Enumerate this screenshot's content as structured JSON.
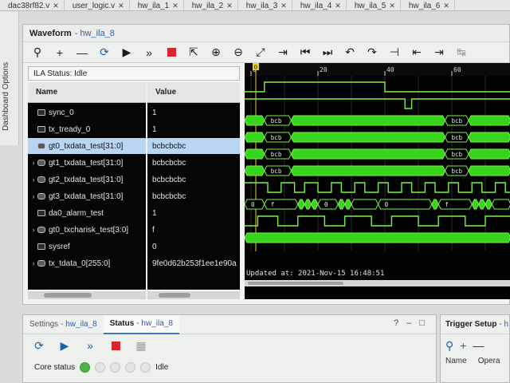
{
  "file_tabs": [
    "dac38rf82.v",
    "user_logic.v",
    "hw_ila_1",
    "hw_ila_2",
    "hw_ila_3",
    "hw_ila_4",
    "hw_ila_5",
    "hw_ila_6"
  ],
  "dashboard_label": "Dashboard Options",
  "waveform": {
    "title": "Waveform",
    "subtitle": "- hw_ila_8",
    "ila_status": "ILA Status:  Idle",
    "name_header": "Name",
    "value_header": "Value",
    "signals": [
      {
        "name": "sync_0",
        "value": "1",
        "bus": false,
        "expandable": false
      },
      {
        "name": "tx_tready_0",
        "value": "1",
        "bus": false,
        "expandable": false
      },
      {
        "name": "gt0_txdata_test[31:0]",
        "value": "bcbcbcbc",
        "bus": true,
        "expandable": true,
        "selected": true
      },
      {
        "name": "gt1_txdata_test[31:0]",
        "value": "bcbcbcbc",
        "bus": true,
        "expandable": true
      },
      {
        "name": "gt2_txdata_test[31:0]",
        "value": "bcbcbcbc",
        "bus": true,
        "expandable": true
      },
      {
        "name": "gt3_txdata_test[31:0]",
        "value": "bcbcbcbc",
        "bus": true,
        "expandable": true
      },
      {
        "name": "da0_alarm_test",
        "value": "1",
        "bus": false,
        "expandable": false
      },
      {
        "name": "gt0_txcharisk_test[3:0]",
        "value": "f",
        "bus": true,
        "expandable": true
      },
      {
        "name": "sysref",
        "value": "0",
        "bus": false,
        "expandable": false
      },
      {
        "name": "tx_tdata_0[255:0]",
        "value": "9fe0d62b253f1ee1e90a",
        "bus": true,
        "expandable": true
      }
    ],
    "cursor_marker": "0",
    "time_ticks": [
      {
        "t": 0,
        "label": "0"
      },
      {
        "t": 20,
        "label": "20"
      },
      {
        "t": 40,
        "label": "40"
      },
      {
        "t": 60,
        "label": "60"
      }
    ],
    "bus_labels": {
      "bcbc": "bcb",
      "charisk": [
        "0",
        "f",
        "0",
        "0",
        "f"
      ]
    },
    "updated_at": "Updated at: 2021-Nov-15 16:48:51",
    "colors": {
      "wave": "#7df04a",
      "bus_fill": "#36d41c",
      "cursor": "#e6d23a",
      "background": "#030303"
    }
  },
  "bottom": {
    "tabs": [
      {
        "label": "Settings",
        "sub": "- hw_ila_8",
        "active": false
      },
      {
        "label": "Status",
        "sub": "- hw_ila_8",
        "active": true
      }
    ],
    "icons": [
      "?",
      "–",
      "□"
    ],
    "core_status_label": "Core status",
    "core_status_value": "Idle"
  },
  "trigger": {
    "title": "Trigger Setup",
    "sub": "- h",
    "columns": [
      "Name",
      "Opera"
    ]
  }
}
